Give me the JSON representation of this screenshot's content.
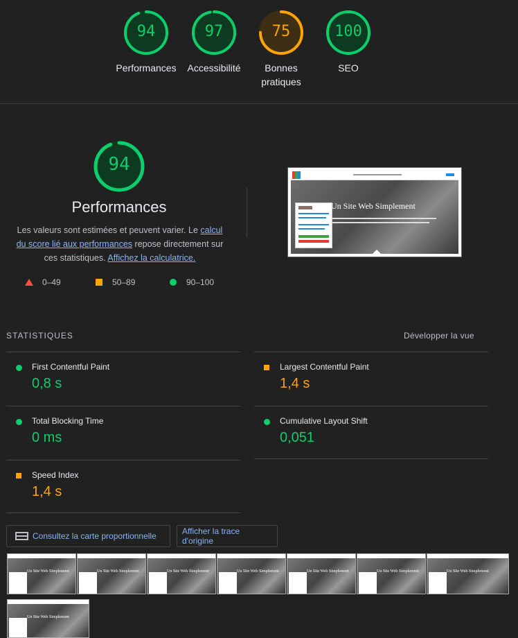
{
  "scores": [
    {
      "value": "94",
      "label": "Performances",
      "score": 94,
      "color": "#0cce6b",
      "bg": "#0d3a21"
    },
    {
      "value": "97",
      "label": "Accessibilité",
      "score": 97,
      "color": "#0cce6b",
      "bg": "#0d3a21"
    },
    {
      "value": "75",
      "label": "Bonnes pratiques",
      "score": 75,
      "color": "#ffa400",
      "bg": "#3e2e14"
    },
    {
      "value": "100",
      "label": "SEO",
      "score": 100,
      "color": "#0cce6b",
      "bg": "#0d3a21"
    }
  ],
  "perf": {
    "score": "94",
    "title": "Performances",
    "desc_1": "Les valeurs sont estimées et peuvent varier. Le ",
    "link_1": "calcul du score lié aux performances",
    "desc_2": " repose directement sur ces statistiques. ",
    "link_2": "Affichez la calculatrice."
  },
  "legend": {
    "fail": "0–49",
    "average": "50–89",
    "pass": "90–100"
  },
  "screenshot": {
    "hero_title": "Un Site Web Simplement"
  },
  "stats": {
    "heading": "STATISTIQUES",
    "expand": "Développer la vue",
    "metrics": [
      {
        "name": "First Contentful Paint",
        "value": "0,8 s",
        "rating": "pass"
      },
      {
        "name": "Largest Contentful Paint",
        "value": "1,4 s",
        "rating": "average"
      },
      {
        "name": "Total Blocking Time",
        "value": "0 ms",
        "rating": "pass"
      },
      {
        "name": "Cumulative Layout Shift",
        "value": "0,051",
        "rating": "pass"
      },
      {
        "name": "Speed Index",
        "value": "1,4 s",
        "rating": "average"
      }
    ]
  },
  "buttons": {
    "treemap": "Consultez la carte proportionnelle",
    "trace": "Afficher la trace d'origine"
  },
  "colors": {
    "pass": "#0cce6b",
    "average": "#ffa400",
    "fail": "#ff4e42",
    "link": "#8ab4f8"
  }
}
